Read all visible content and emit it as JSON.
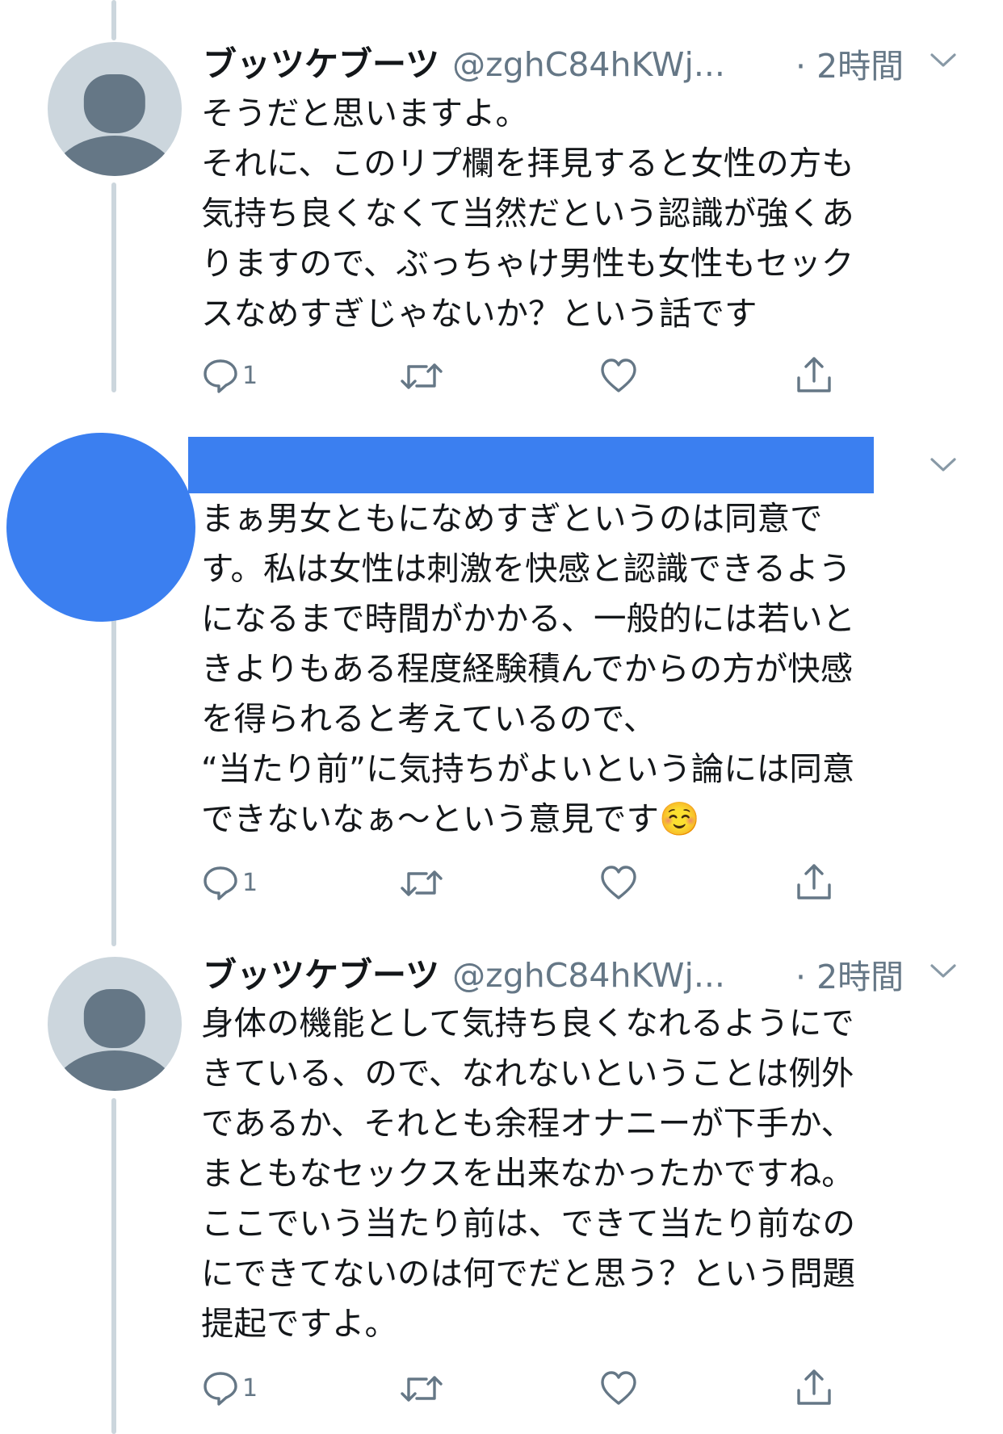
{
  "tweets": [
    {
      "name": "ブッツケブーツ",
      "handle": "@zghC84hKWj...",
      "time": "· 2時間",
      "text": "そうだと思いますよ。\nそれに、このリプ欄を拝見すると女性の方も\n気持ち良くなくて当然だという認識が強くあ\nりますので、ぶっちゃけ男性も女性もセック\nスなめすぎじゃないか？という話です",
      "reply_count": "1"
    },
    {
      "name": "",
      "handle": "",
      "time": "",
      "text": "まぁ男女ともになめすぎというのは同意で\nす。私は女性は刺激を快感と認識できるよう\nになるまで時間がかかる、一般的には若いと\nきよりもある程度経験積んでからの方が快感\nを得られると考えているので、\n“当たり前”に気持ちがよいという論には同意\nできないなぁ〜という意見です☺️",
      "reply_count": "1"
    },
    {
      "name": "ブッツケブーツ",
      "handle": "@zghC84hKWj...",
      "time": "· 2時間",
      "text": "身体の機能として気持ち良くなれるようにで\nきている、ので、なれないということは例外\nであるか、それとも余程オナニーが下手か、\nまともなセックスを出来なかったかですね。\nここでいう当たり前は、できて当たり前なの\nにできてないのは何でだと思う？という問題\n提起ですよ。",
      "reply_count": "1"
    }
  ],
  "icons": [
    "reply-icon",
    "retweet-icon",
    "like-icon",
    "share-icon",
    "chevron-down-icon",
    "default-avatar-icon"
  ],
  "colors": {
    "text": "#14171a",
    "secondary": "#657786",
    "thread_line": "#ccd6dd",
    "redaction": "#3b7ff0"
  }
}
